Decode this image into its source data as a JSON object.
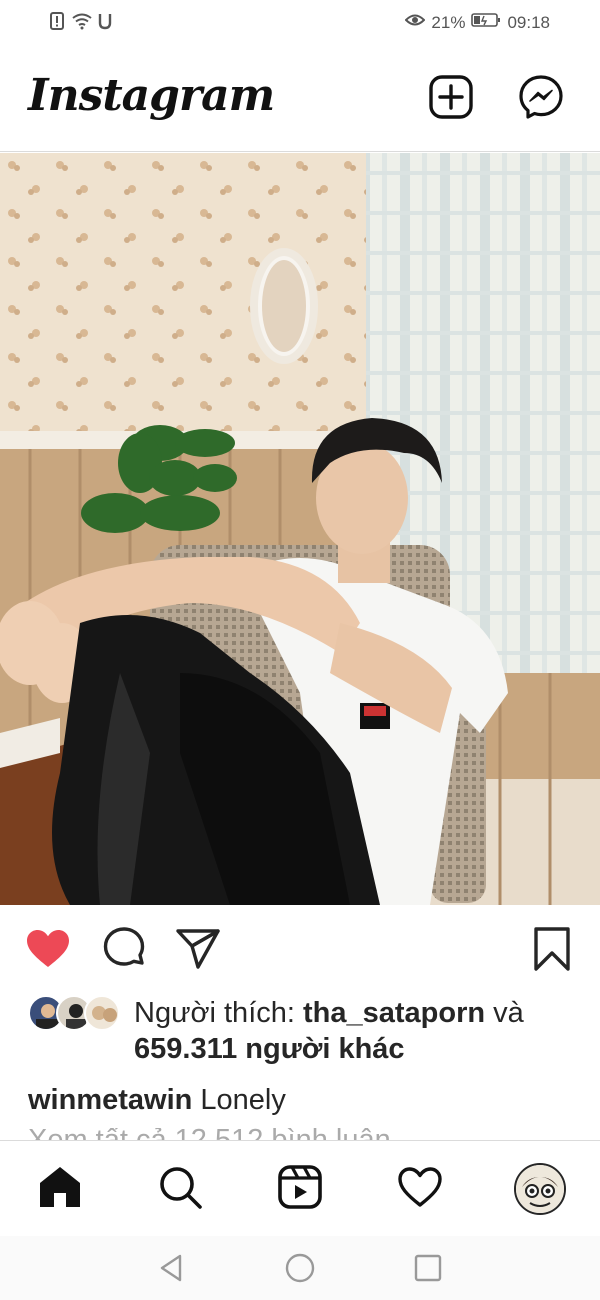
{
  "status_bar": {
    "left_icons": [
      "alert-icon",
      "wifi-icon",
      "u-icon"
    ],
    "battery_percent": "21%",
    "time": "09:18"
  },
  "header": {
    "logo": "Instagram",
    "new_post_icon": "plus-square-icon",
    "messenger_icon": "messenger-icon"
  },
  "post": {
    "liked": true,
    "likes_prefix": "Người thích: ",
    "liked_by_user": "tha_sataporn",
    "likes_joiner": " và",
    "likes_others": "659.311 người khác",
    "author": "winmetawin",
    "caption": " Lonely",
    "comments_peek": "Xem tất cả 12.512 bình luận"
  },
  "actions": {
    "like_icon": "heart-filled-icon",
    "comment_icon": "comment-icon",
    "share_icon": "send-icon",
    "save_icon": "bookmark-icon"
  },
  "bottom_nav": [
    "home-icon",
    "search-icon",
    "reels-icon",
    "activity-icon",
    "profile-avatar"
  ],
  "system_nav": [
    "back-icon",
    "home-circle-icon",
    "recents-icon"
  ],
  "colors": {
    "heart": "#ed4956",
    "text": "#262626",
    "divider": "#dbdbdb"
  }
}
